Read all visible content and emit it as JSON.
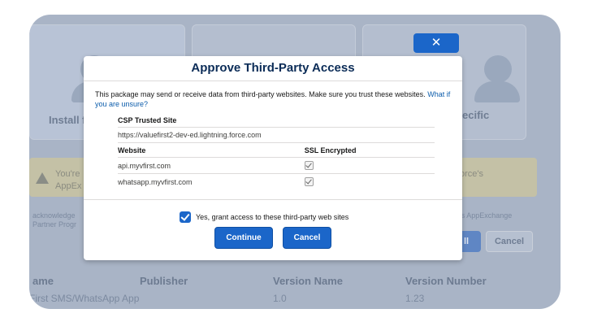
{
  "background": {
    "card1_label": "Install f",
    "card3_label": "ecific",
    "warning_text_1": "You're",
    "warning_text_2": "AppEx",
    "warning_text_right": "orce's",
    "ack_text_1": "acknowledge",
    "ack_text_2": "Partner Progr",
    "ack_text_right": "'s AppExchange",
    "install_btn": "ll",
    "cancel_btn": "Cancel",
    "close_glyph": "✕",
    "table": {
      "headers": [
        "ame",
        "Publisher",
        "Version Name",
        "Version Number"
      ],
      "row": [
        "First SMS/WhatsApp App",
        "",
        "1.0",
        "1.23"
      ]
    }
  },
  "modal": {
    "title": "Approve Third-Party Access",
    "intro": "This package may send or receive data from third-party websites. Make sure you trust these websites.",
    "intro_link": "What if you are unsure?",
    "csp_header": "CSP Trusted Site",
    "csp_url": "https://valuefirst2-dev-ed.lightning.force.com",
    "website_header": "Website",
    "ssl_header": "SSL Encrypted",
    "sites": [
      {
        "url": "api.myvfirst.com",
        "ssl": true
      },
      {
        "url": "whatsapp.myvfirst.com",
        "ssl": true
      }
    ],
    "grant_label": "Yes, grant access to these third-party web sites",
    "grant_checked": true,
    "continue_label": "Continue",
    "cancel_label": "Cancel"
  },
  "colors": {
    "brand": "#1b66c9",
    "title": "#0b2c57",
    "overlay": "#a9b4c6"
  }
}
